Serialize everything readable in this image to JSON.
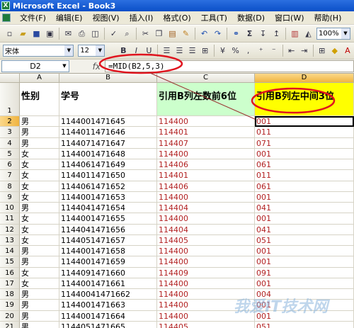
{
  "app": {
    "title": "Microsoft Excel - Book3"
  },
  "menu": [
    "文件(F)",
    "编辑(E)",
    "视图(V)",
    "插入(I)",
    "格式(O)",
    "工具(T)",
    "数据(D)",
    "窗口(W)",
    "帮助(H)"
  ],
  "toolbar": {
    "zoom": "100%",
    "font_name": "宋体",
    "font_size": "12",
    "bold": "B",
    "italic": "I",
    "underline": "U",
    "sigma": "Σ"
  },
  "formula_bar": {
    "name_box": "D2",
    "fx": "fx",
    "formula": "=MID(B2,5,3)"
  },
  "columns": [
    "A",
    "B",
    "C",
    "D"
  ],
  "header_row": {
    "row_num": "1",
    "a": "性别",
    "b": "学号",
    "c": "引用B列左数前6位",
    "d": "引用B列左中间3位"
  },
  "rows": [
    {
      "n": "2",
      "a": "男",
      "b": "1144001471645",
      "c": "114400",
      "d": "001"
    },
    {
      "n": "3",
      "a": "男",
      "b": "1144011471646",
      "c": "114401",
      "d": "011"
    },
    {
      "n": "4",
      "a": "男",
      "b": "1144071471647",
      "c": "114407",
      "d": "071"
    },
    {
      "n": "5",
      "a": "女",
      "b": "1144001471648",
      "c": "114400",
      "d": "001"
    },
    {
      "n": "6",
      "a": "女",
      "b": "1144061471649",
      "c": "114406",
      "d": "061"
    },
    {
      "n": "7",
      "a": "女",
      "b": "1144011471650",
      "c": "114401",
      "d": "011"
    },
    {
      "n": "8",
      "a": "女",
      "b": "1144061471652",
      "c": "114406",
      "d": "061"
    },
    {
      "n": "9",
      "a": "女",
      "b": "1144001471653",
      "c": "114400",
      "d": "001"
    },
    {
      "n": "10",
      "a": "男",
      "b": "1144041471654",
      "c": "114404",
      "d": "041"
    },
    {
      "n": "11",
      "a": "女",
      "b": "1144001471655",
      "c": "114400",
      "d": "001"
    },
    {
      "n": "12",
      "a": "女",
      "b": "1144041471656",
      "c": "114404",
      "d": "041"
    },
    {
      "n": "13",
      "a": "女",
      "b": "1144051471657",
      "c": "114405",
      "d": "051"
    },
    {
      "n": "14",
      "a": "男",
      "b": "1144001471658",
      "c": "114400",
      "d": "001"
    },
    {
      "n": "15",
      "a": "男",
      "b": "1144001471659",
      "c": "114400",
      "d": "001"
    },
    {
      "n": "16",
      "a": "女",
      "b": "1144091471660",
      "c": "114409",
      "d": "091"
    },
    {
      "n": "17",
      "a": "女",
      "b": "1144001471661",
      "c": "114400",
      "d": "001"
    },
    {
      "n": "18",
      "a": "男",
      "b": "11440041471662",
      "c": "114400",
      "d": "004"
    },
    {
      "n": "19",
      "a": "男",
      "b": "1144001471663",
      "c": "114400",
      "d": "001"
    },
    {
      "n": "20",
      "a": "男",
      "b": "1144001471664",
      "c": "114400",
      "d": "001"
    },
    {
      "n": "21",
      "a": "男",
      "b": "1144051471665",
      "c": "114405",
      "d": "051"
    }
  ],
  "watermark": "我爱IT技术网",
  "colors": {
    "header_yellow": "#ffff00",
    "header_green": "#ccffcc",
    "annotation_red": "#e0141e",
    "value_red": "#b22222"
  }
}
